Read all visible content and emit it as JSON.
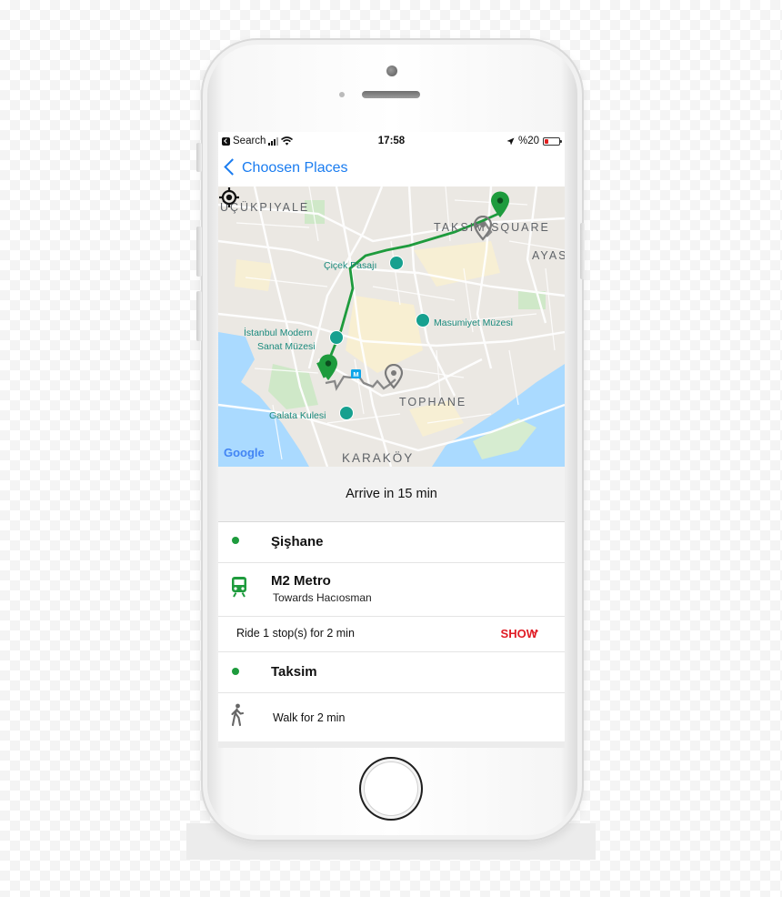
{
  "status_bar": {
    "back_app": "Search",
    "time": "17:58",
    "battery": "%20"
  },
  "nav": {
    "back_label": "Choosen Places"
  },
  "map": {
    "area_labels": [
      "ÜÇÜKPIYALE",
      "TAKSIM SQUARE",
      "AYAS",
      "TOPHANE",
      "KARAKÖY"
    ],
    "poi_labels": [
      "Çiçek Pasajı",
      "İstanbul Modern",
      "Sanat Müzesi",
      "Masumiyet Müzesi",
      "Galata Kulesi"
    ],
    "metro_badge": "M",
    "logo": "Google"
  },
  "summary": {
    "arrive": "Arrive in 15 min"
  },
  "steps": {
    "start_stop": "Şişhane",
    "transit_line": "M2 Metro",
    "transit_direction": "Towards Hacıosman",
    "ride_info": "Ride 1 stop(s) for 2 min",
    "show_label": "SHOW",
    "end_stop": "Taksim",
    "walk_info": "Walk for 2 min"
  },
  "colors": {
    "accent_blue": "#1a7cf0",
    "route_green": "#1e9b3d",
    "show_red": "#e01b24"
  }
}
